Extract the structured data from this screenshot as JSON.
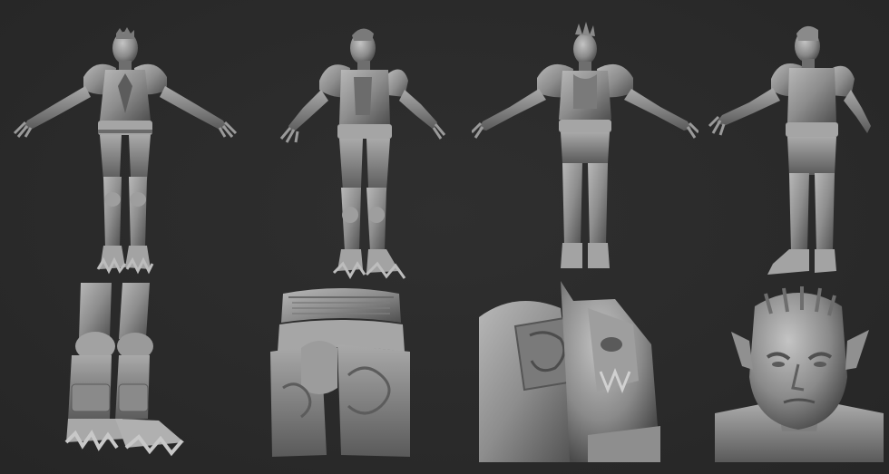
{
  "sheet": {
    "background_color": "#2b2b2b",
    "clay_color": "#8c8c8c",
    "clay_highlight": "#b9b9b9",
    "clay_shadow": "#4a4a4a"
  },
  "views": [
    {
      "name": "front-full-body"
    },
    {
      "name": "three-quarter-front-full-body"
    },
    {
      "name": "back-full-body"
    },
    {
      "name": "three-quarter-back-full-body"
    }
  ],
  "closeups": [
    {
      "name": "boots-closeup"
    },
    {
      "name": "belt-and-tassets-closeup"
    },
    {
      "name": "shoulder-pauldron-closeup"
    },
    {
      "name": "head-bust-closeup"
    }
  ]
}
